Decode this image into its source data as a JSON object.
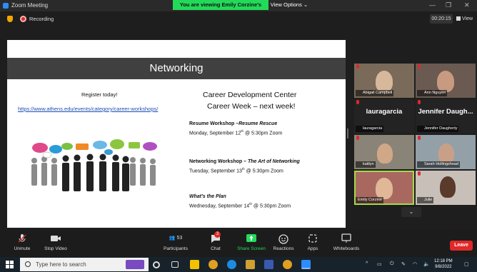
{
  "window": {
    "title": "Zoom Meeting",
    "viewing_banner": "You are viewing Emily Corzine's screen",
    "view_options": "View Options ⌄",
    "minimize": "—",
    "restore": "❐",
    "close": "✕"
  },
  "recording": {
    "label": "Recording",
    "timer": "00:20:15",
    "view_label": "View"
  },
  "slide": {
    "title": "Networking",
    "register": "Register today!",
    "link": "https://www.athens.edu/events/category/career-workshops/",
    "cdc_line1": "Career Development Center",
    "cdc_line2": "Career Week – next week!",
    "events": [
      {
        "title_bold": "Resume Workshop –",
        "title_italic": "Resume Rescue",
        "date_pre": "Monday, September 12",
        "date_sup": "th",
        "date_post": " @ 5:30pm Zoom"
      },
      {
        "title_bold": "Networking Workshop – ",
        "title_italic": "The Art of Networking",
        "date_pre": "Tuesday, September 13",
        "date_sup": "th",
        "date_post": " @ 5:30pm Zoom"
      },
      {
        "title_bold": "",
        "title_italic": "What's the Plan",
        "date_pre": "Wednesday, September 14",
        "date_sup": "th",
        "date_post": " @ 5:30pm Zoom"
      }
    ]
  },
  "participants": [
    {
      "name": "Abigail Campbell",
      "big": ""
    },
    {
      "name": "Ann Nguyen",
      "big": ""
    },
    {
      "name": "lauragarcia",
      "big": "lauragarcia"
    },
    {
      "name": "Jennifer Daugherty",
      "big": "Jennifer Daugh..."
    },
    {
      "name": "kaitlyn",
      "big": ""
    },
    {
      "name": "Sarah Hollingshead",
      "big": ""
    },
    {
      "name": "Emily Corzine",
      "big": ""
    },
    {
      "name": "Julie",
      "big": ""
    }
  ],
  "expand_label": "⌄",
  "toolbar": {
    "unmute": "Unmute",
    "stop_video": "Stop Video",
    "participants": "Participants",
    "participants_count": "53",
    "chat": "Chat",
    "chat_badge": "3",
    "share_screen": "Share Screen",
    "reactions": "Reactions",
    "apps": "Apps",
    "whiteboards": "Whiteboards",
    "leave": "Leave"
  },
  "taskbar": {
    "search_placeholder": "Type here to search",
    "time": "12:18 PM",
    "date": "9/8/2022"
  },
  "colors": {
    "accent": "#2d8cff",
    "share_green": "#23d959",
    "leave_red": "#e02828",
    "active_speaker": "#a7d94a"
  }
}
